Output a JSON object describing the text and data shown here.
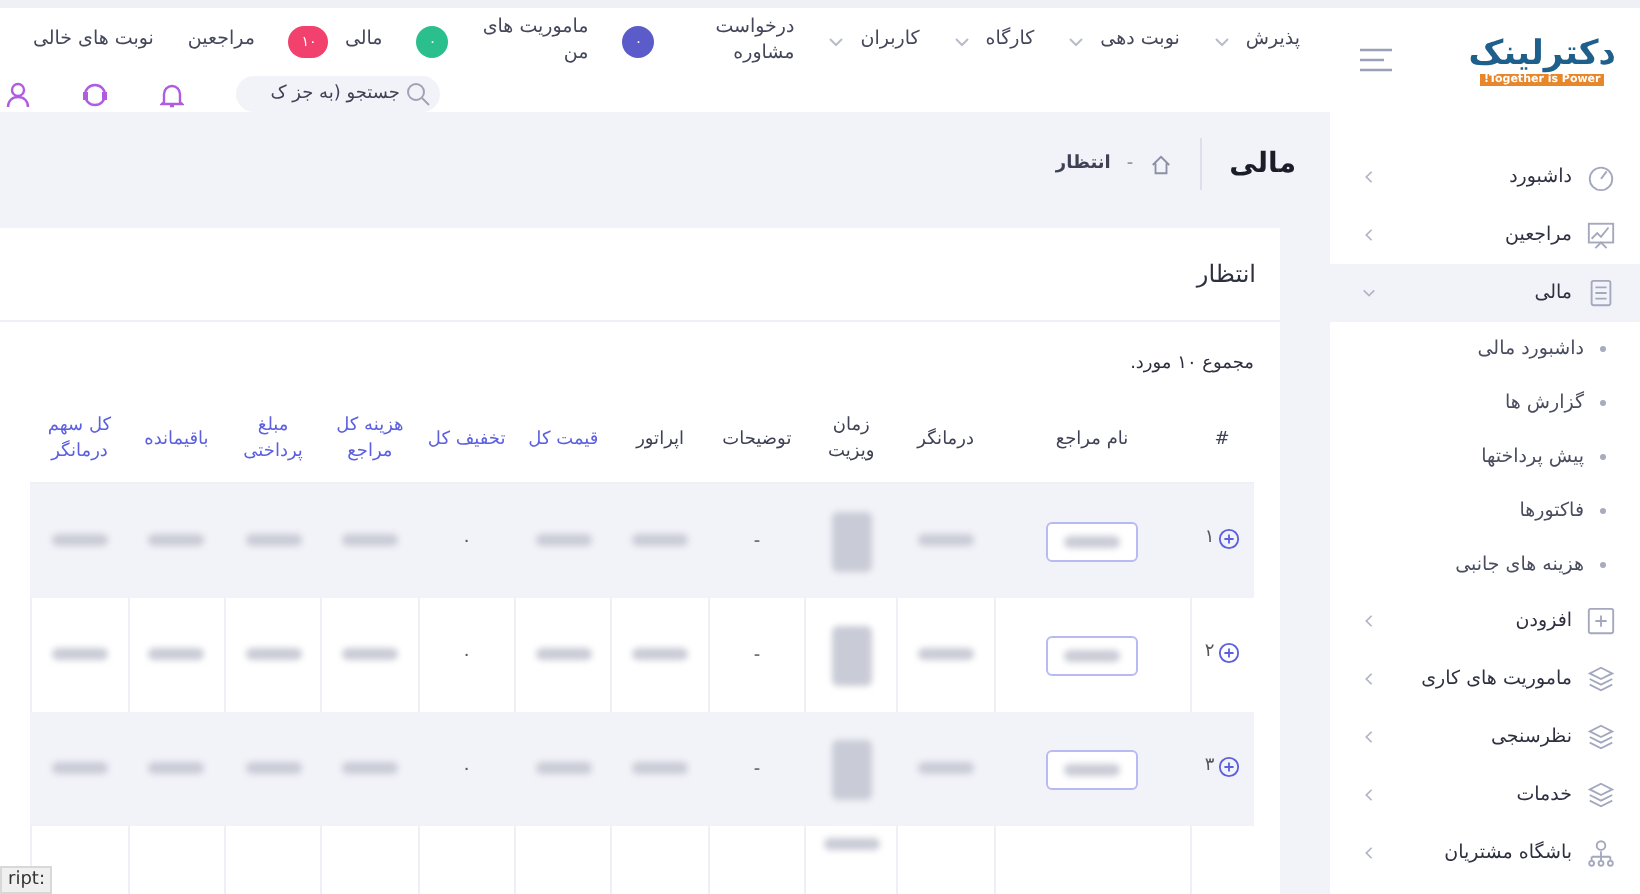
{
  "logo": {
    "name": "دکترلینک",
    "tagline": "Together is Power!"
  },
  "nav": [
    {
      "label": "پذیرش",
      "kind": "dropdown"
    },
    {
      "label": "نوبت دهی",
      "kind": "dropdown"
    },
    {
      "label": "کارگاه",
      "kind": "dropdown"
    },
    {
      "label": "کاربران",
      "kind": "dropdown"
    },
    {
      "label": "درخواست مشاوره",
      "kind": "badge",
      "badge": "٠",
      "color": "#5b5cc9"
    },
    {
      "label": "ماموریت های من",
      "kind": "badge",
      "badge": "٠",
      "color": "#2bbf8e"
    },
    {
      "label": "مالی",
      "kind": "badge",
      "badge": "۱۰",
      "color": "#f1416c"
    },
    {
      "label": "مراجعین",
      "kind": "plain"
    },
    {
      "label": "نوبت های خالی",
      "kind": "plain"
    }
  ],
  "search": {
    "placeholder": "جستجو (به جز ک"
  },
  "page_title": "مالی",
  "breadcrumb": [
    {
      "separator": "-",
      "label": "انتظار"
    }
  ],
  "card": {
    "title": "انتظار",
    "summary": "مجموع ۱۰ مورد."
  },
  "table": {
    "columns": [
      {
        "label": "#",
        "kind": "number",
        "accent": false
      },
      {
        "label": "نام مراجع",
        "kind": "name",
        "accent": false
      },
      {
        "label": "درمانگر",
        "kind": "blur",
        "accent": false
      },
      {
        "label": "زمان ویزیت",
        "kind": "blur3",
        "accent": false
      },
      {
        "label": "توضیحات",
        "kind": "description",
        "accent": false
      },
      {
        "label": "اپراتور",
        "kind": "blur",
        "accent": false
      },
      {
        "label": "قیمت کل",
        "kind": "blur",
        "accent": true
      },
      {
        "label": "تخفیف کل",
        "kind": "discount",
        "accent": true
      },
      {
        "label": "هزینه کل مراجع",
        "kind": "blur",
        "accent": true
      },
      {
        "label": "مبلغ پرداختی",
        "kind": "blur",
        "accent": true
      },
      {
        "label": "باقیمانده",
        "kind": "blur",
        "accent": true
      },
      {
        "label": "کل سهم درمانگر",
        "kind": "blur",
        "accent": true
      }
    ],
    "rows": [
      {
        "kind": "full",
        "number": "۱",
        "discount": "٠",
        "description": "-"
      },
      {
        "kind": "full",
        "number": "۲",
        "discount": "٠",
        "description": "-"
      },
      {
        "kind": "full",
        "number": "۳",
        "discount": "٠",
        "description": "-"
      },
      {
        "kind": "cut"
      }
    ]
  },
  "sidebar": {
    "items": [
      {
        "label": "داشبورد",
        "expanded": false
      },
      {
        "label": "مراجعین",
        "expanded": false
      },
      {
        "label": "مالی",
        "expanded": true,
        "children": [
          {
            "label": "داشبورد مالی"
          },
          {
            "label": "گزارش ها"
          },
          {
            "label": "پیش پرداختها"
          },
          {
            "label": "فاکتورها"
          },
          {
            "label": "هزینه های جانبی"
          }
        ]
      },
      {
        "label": "افزودن",
        "expanded": false
      },
      {
        "label": "ماموریت های کاری",
        "expanded": false
      },
      {
        "label": "نظرسنجی",
        "expanded": false
      },
      {
        "label": "خدمات",
        "expanded": false
      },
      {
        "label": "باشگاه مشتریان",
        "expanded": false
      }
    ]
  },
  "status_text": "ript:"
}
